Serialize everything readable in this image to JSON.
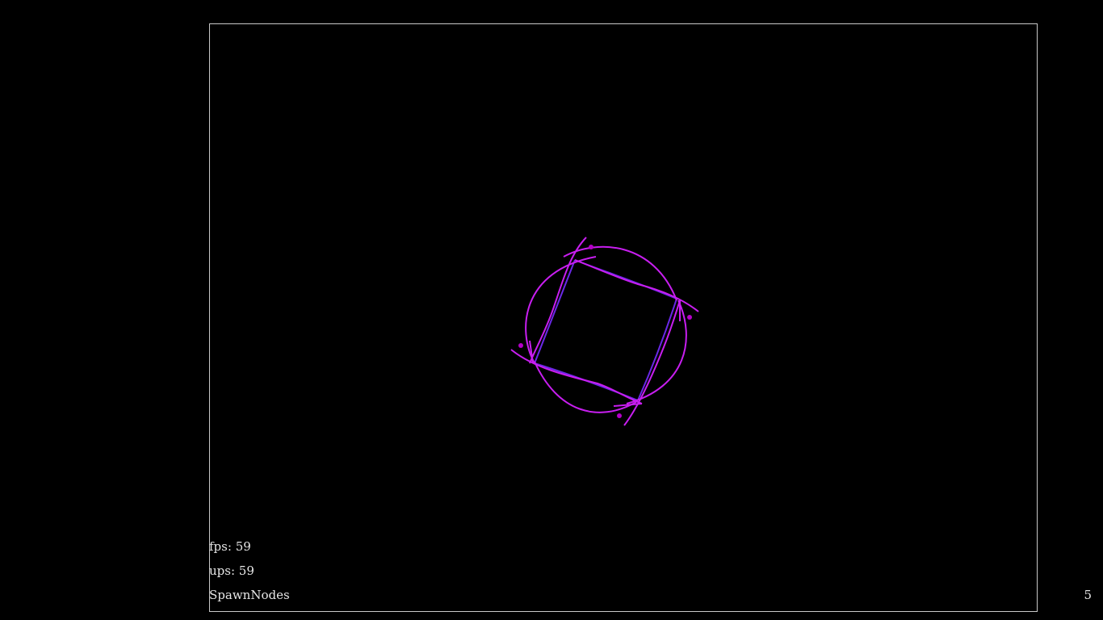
{
  "hud": {
    "fps_label": "fps:",
    "fps_value": "59",
    "ups_label": "ups:",
    "ups_value": "59",
    "mode": "SpawnNodes"
  },
  "corner": {
    "count": "5"
  },
  "colors": {
    "background": "#000000",
    "frame": "#c8c8c8",
    "strand": "#c81ef0",
    "inner_strand": "#6a28e6",
    "node": "#b400c8",
    "text": "#e6e6e6"
  }
}
